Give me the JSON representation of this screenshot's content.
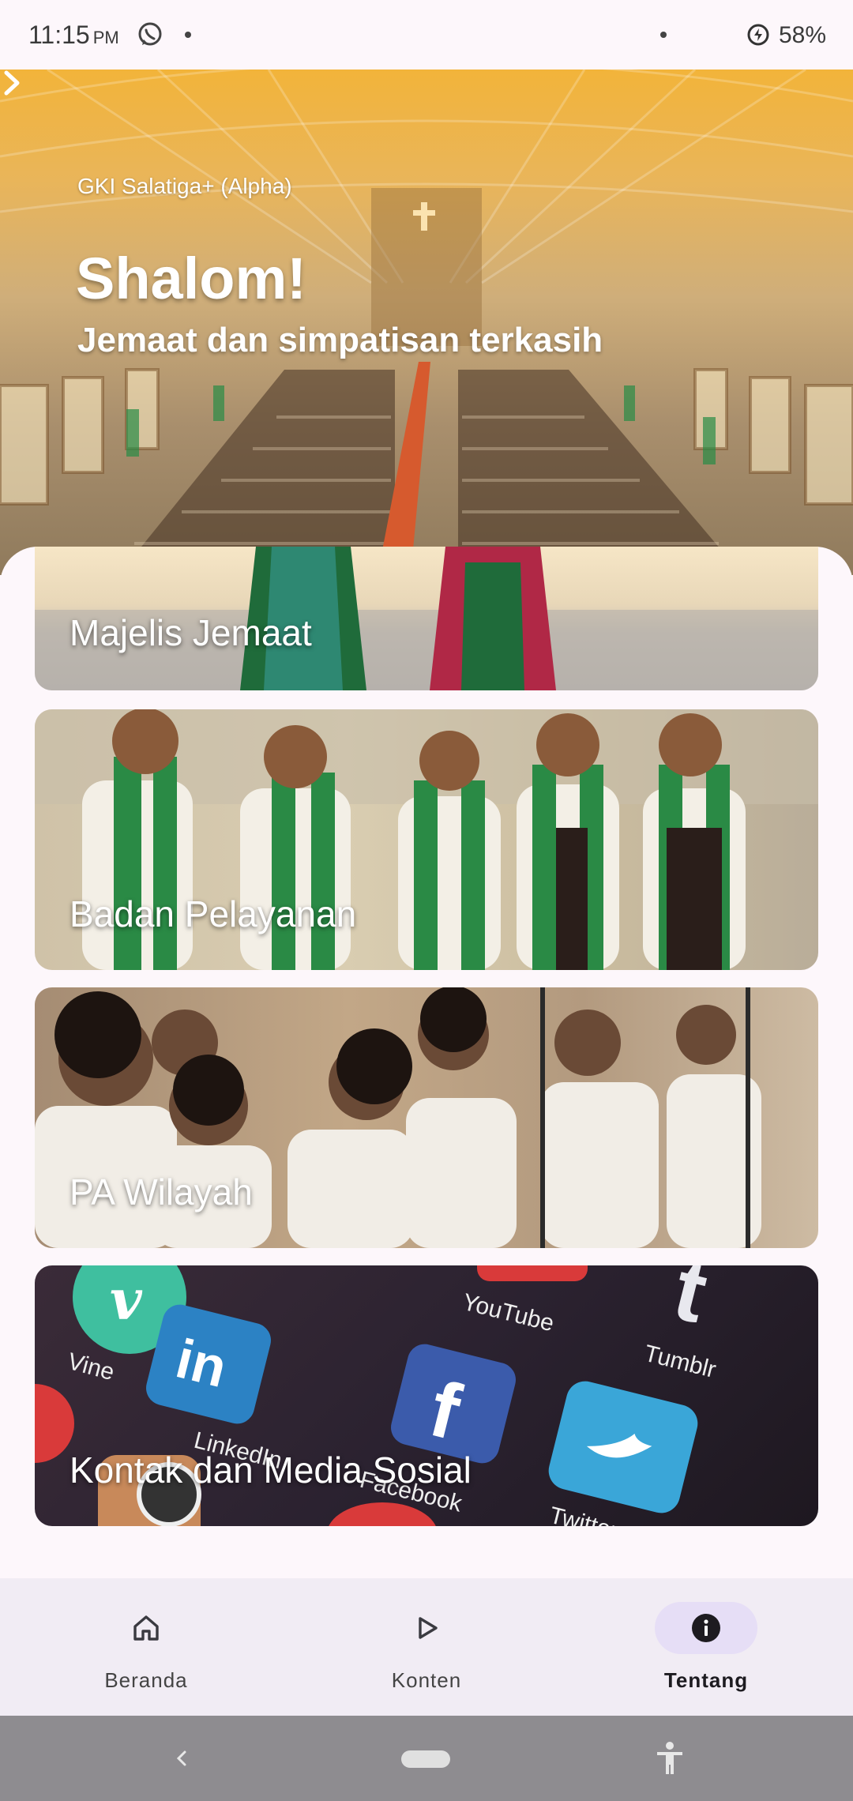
{
  "status_bar": {
    "time": "11:15",
    "ampm": "PM",
    "battery": "58%"
  },
  "hero": {
    "org": "GKI Salatiga+ (Alpha)",
    "title": "Shalom!",
    "subtitle": "Jemaat dan simpatisan terkasih"
  },
  "cards": [
    {
      "label": "Majelis Jemaat"
    },
    {
      "label": "Badan Pelayanan"
    },
    {
      "label": "PA Wilayah"
    },
    {
      "label": "Kontak dan Media Sosial",
      "social_texts": [
        "Vine",
        "LinkedIn",
        "YouTube",
        "Facebook",
        "Tumblr",
        "Twitter"
      ]
    }
  ],
  "nav": [
    {
      "label": "Beranda",
      "icon": "home-icon",
      "active": false
    },
    {
      "label": "Konten",
      "icon": "play-icon",
      "active": false
    },
    {
      "label": "Tentang",
      "icon": "info-icon",
      "active": true
    }
  ],
  "colors": {
    "accent_pill": "#e6def6",
    "hero_top": "#f2b43a"
  }
}
